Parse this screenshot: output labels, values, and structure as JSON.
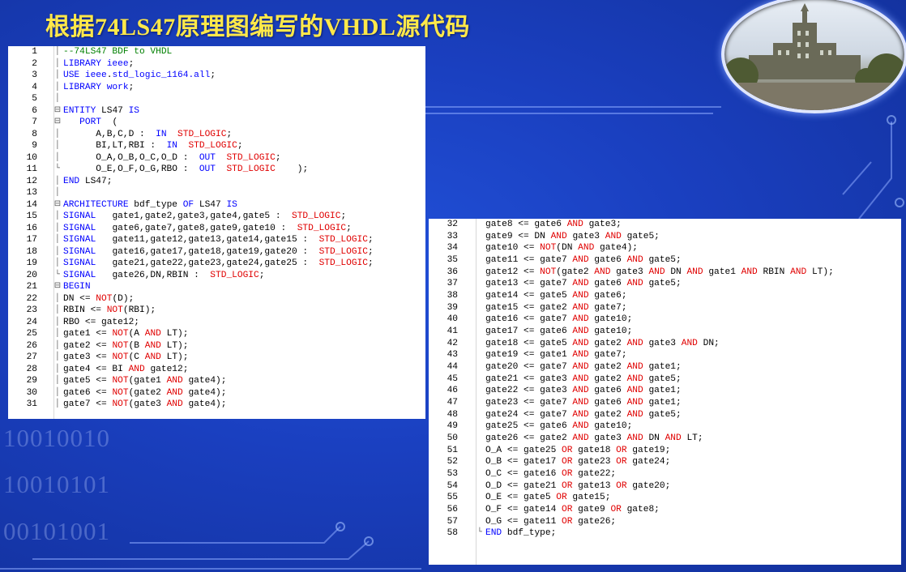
{
  "slide_title": "根据74LS47原理图编写的VHDL源代码",
  "binary_deco": [
    "10010010",
    "10010101",
    "00101001"
  ],
  "panel1": {
    "lines": [
      {
        "n": "1",
        "t": "--74LS47 BDF to VHDL"
      },
      {
        "n": "2",
        "t": "LIBRARY ieee;"
      },
      {
        "n": "3",
        "t": "USE ieee.std_logic_1164.all;"
      },
      {
        "n": "4",
        "t": "LIBRARY work;"
      },
      {
        "n": "5",
        "t": ""
      },
      {
        "n": "6",
        "t": "ENTITY LS47 IS"
      },
      {
        "n": "7",
        "t": "   PORT  ("
      },
      {
        "n": "8",
        "t": "      A,B,C,D :  IN  STD_LOGIC;"
      },
      {
        "n": "9",
        "t": "      BI,LT,RBI :  IN  STD_LOGIC;"
      },
      {
        "n": "10",
        "t": "      O_A,O_B,O_C,O_D :  OUT  STD_LOGIC;"
      },
      {
        "n": "11",
        "t": "      O_E,O_F,O_G,RBO :  OUT  STD_LOGIC    );"
      },
      {
        "n": "12",
        "t": "END LS47;"
      },
      {
        "n": "13",
        "t": ""
      },
      {
        "n": "14",
        "t": "ARCHITECTURE bdf_type OF LS47 IS"
      },
      {
        "n": "15",
        "t": "SIGNAL   gate1,gate2,gate3,gate4,gate5 :  STD_LOGIC;"
      },
      {
        "n": "16",
        "t": "SIGNAL   gate6,gate7,gate8,gate9,gate10 :  STD_LOGIC;"
      },
      {
        "n": "17",
        "t": "SIGNAL   gate11,gate12,gate13,gate14,gate15 :  STD_LOGIC;"
      },
      {
        "n": "18",
        "t": "SIGNAL   gate16,gate17,gate18,gate19,gate20 :  STD_LOGIC;"
      },
      {
        "n": "19",
        "t": "SIGNAL   gate21,gate22,gate23,gate24,gate25 :  STD_LOGIC;"
      },
      {
        "n": "20",
        "t": "SIGNAL   gate26,DN,RBIN :  STD_LOGIC;"
      },
      {
        "n": "21",
        "t": "BEGIN"
      },
      {
        "n": "22",
        "t": "DN <= NOT(D);"
      },
      {
        "n": "23",
        "t": "RBIN <= NOT(RBI);"
      },
      {
        "n": "24",
        "t": "RBO <= gate12;"
      },
      {
        "n": "25",
        "t": "gate1 <= NOT(A AND LT);"
      },
      {
        "n": "26",
        "t": "gate2 <= NOT(B AND LT);"
      },
      {
        "n": "27",
        "t": "gate3 <= NOT(C AND LT);"
      },
      {
        "n": "28",
        "t": "gate4 <= BI AND gate12;"
      },
      {
        "n": "29",
        "t": "gate5 <= NOT(gate1 AND gate4);"
      },
      {
        "n": "30",
        "t": "gate6 <= NOT(gate2 AND gate4);"
      },
      {
        "n": "31",
        "t": "gate7 <= NOT(gate3 AND gate4);"
      }
    ]
  },
  "panel2": {
    "lines": [
      {
        "n": "32",
        "t": "gate8 <= gate6 AND gate3;"
      },
      {
        "n": "33",
        "t": "gate9 <= DN AND gate3 AND gate5;"
      },
      {
        "n": "34",
        "t": "gate10 <= NOT(DN AND gate4);"
      },
      {
        "n": "35",
        "t": "gate11 <= gate7 AND gate6 AND gate5;"
      },
      {
        "n": "36",
        "t": "gate12 <= NOT(gate2 AND gate3 AND DN AND gate1 AND RBIN AND LT);"
      },
      {
        "n": "37",
        "t": "gate13 <= gate7 AND gate6 AND gate5;"
      },
      {
        "n": "38",
        "t": "gate14 <= gate5 AND gate6;"
      },
      {
        "n": "39",
        "t": "gate15 <= gate2 AND gate7;"
      },
      {
        "n": "40",
        "t": "gate16 <= gate7 AND gate10;"
      },
      {
        "n": "41",
        "t": "gate17 <= gate6 AND gate10;"
      },
      {
        "n": "42",
        "t": "gate18 <= gate5 AND gate2 AND gate3 AND DN;"
      },
      {
        "n": "43",
        "t": "gate19 <= gate1 AND gate7;"
      },
      {
        "n": "44",
        "t": "gate20 <= gate7 AND gate2 AND gate1;"
      },
      {
        "n": "45",
        "t": "gate21 <= gate3 AND gate2 AND gate5;"
      },
      {
        "n": "46",
        "t": "gate22 <= gate3 AND gate6 AND gate1;"
      },
      {
        "n": "47",
        "t": "gate23 <= gate7 AND gate6 AND gate1;"
      },
      {
        "n": "48",
        "t": "gate24 <= gate7 AND gate2 AND gate5;"
      },
      {
        "n": "49",
        "t": "gate25 <= gate6 AND gate10;"
      },
      {
        "n": "50",
        "t": "gate26 <= gate2 AND gate3 AND DN AND LT;"
      },
      {
        "n": "51",
        "t": "O_A <= gate25 OR gate18 OR gate19;"
      },
      {
        "n": "52",
        "t": "O_B <= gate17 OR gate23 OR gate24;"
      },
      {
        "n": "53",
        "t": "O_C <= gate16 OR gate22;"
      },
      {
        "n": "54",
        "t": "O_D <= gate21 OR gate13 OR gate20;"
      },
      {
        "n": "55",
        "t": "O_E <= gate5 OR gate15;"
      },
      {
        "n": "56",
        "t": "O_F <= gate14 OR gate9 OR gate8;"
      },
      {
        "n": "57",
        "t": "O_G <= gate11 OR gate26;"
      },
      {
        "n": "58",
        "t": "END bdf_type;"
      }
    ]
  },
  "colors": {
    "keyword": "#0000ff",
    "operator": "#e00000",
    "comment": "#008000",
    "title": "#ffe84a"
  }
}
